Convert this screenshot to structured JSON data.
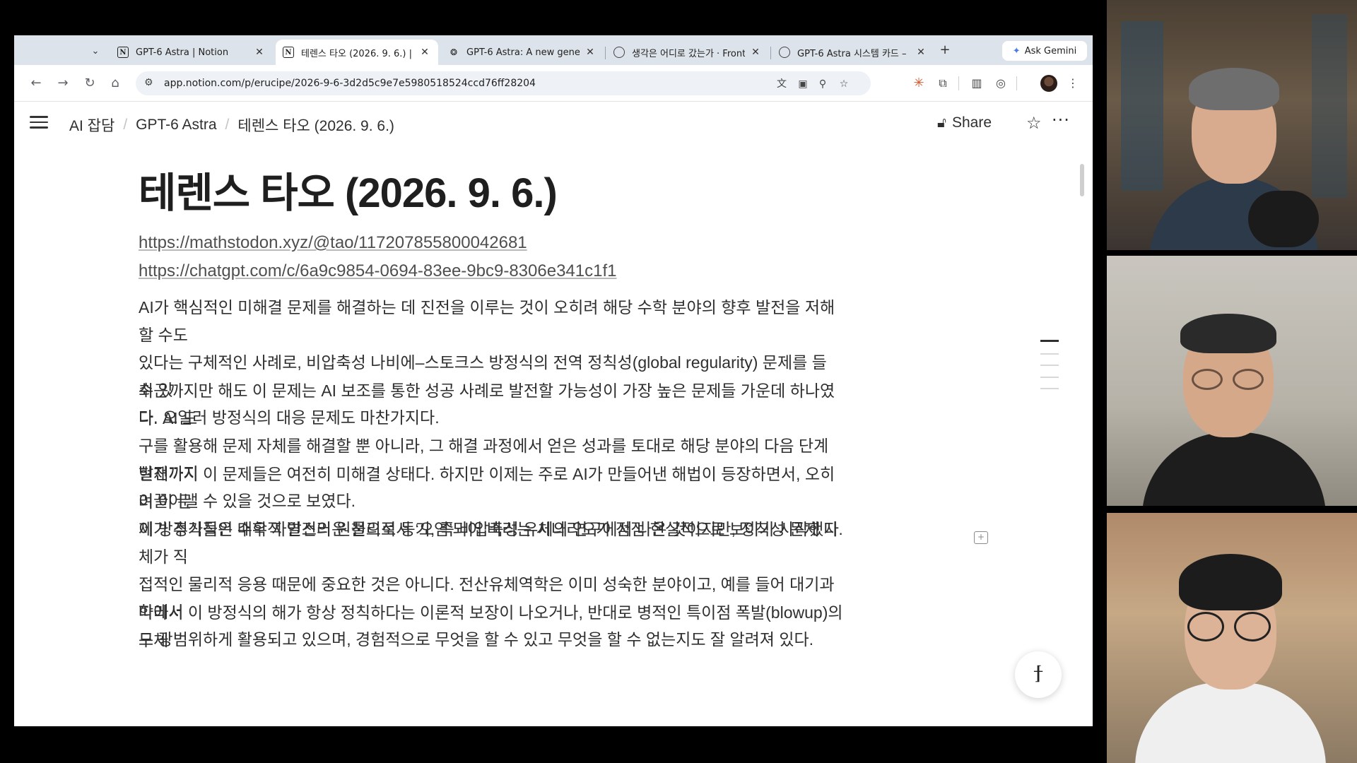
{
  "browser": {
    "tab_dropdown_icon": "chevron-down-icon",
    "tabs": [
      {
        "label": "GPT-6 Astra | Notion",
        "icon": "notion-icon",
        "active": false
      },
      {
        "label": "테렌스 타오 (2026. 9. 6.) |",
        "icon": "notion-icon",
        "active": true
      },
      {
        "label": "GPT-6 Astra: A new gene",
        "icon": "openai-icon",
        "active": false
      },
      {
        "label": "생각은 어디로 갔는가 · Front",
        "icon": "globe-icon",
        "active": false
      },
      {
        "label": "GPT-6 Astra 시스템 카드 –",
        "icon": "globe-icon",
        "active": false
      }
    ],
    "new_tab": "+",
    "gemini_label": "Ask Gemini",
    "url": "app.notion.com/p/erucipe/2026-9-6-3d2d5c9e7e5980518524ccd76ff28204"
  },
  "notion": {
    "breadcrumbs": [
      "AI 잡담",
      "GPT-6 Astra",
      "테렌스 타오 (2026. 9. 6.)"
    ],
    "share_label": "Share",
    "title": "테렌스 타오 (2026. 9. 6.)",
    "links": [
      "https://mathstodon.xyz/@tao/117207855800042681",
      "https://chatgpt.com/c/6a9c9854-0694-83ee-9bc9-8306e341c1f1"
    ],
    "paragraphs": [
      [
        "AI가 핵심적인 미해결 문제를 해결하는 데 진전을 이루는 것이 오히려 해당 수학 분야의 향후 발전을 저해할 수도",
        "있다는 구체적인 사례로, 비압축성 나비에–스토크스 방정식의 전역 정칙성(global regularity) 문제를 들 수 있",
        "다. 오일러 방정식의 대응 문제도 마찬가지다."
      ],
      [
        "최근까지만 해도 이 문제는 AI 보조를 통한 성공 사례로 발전할 가능성이 가장 높은 문제들 가운데 하나였다. AI 도",
        "구를 활용해 문제 자체를 해결할 뿐 아니라, 그 해결 과정에서 얻은 성과를 토대로 해당 분야의 다음 단계 발전까지",
        "이끌어낼 수 있을 것으로 보였다."
      ],
      [
        "현재까지 이 문제들은 여전히 미해결 상태다. 하지만 이제는 주로 AI가 만들어낸 해법이 등장하면서, 오히려 이 문",
        "제가 추가적인 수학적 발전의 원천으로서 ‘오염’되어 버리는 시나리오가 점점 현실적으로 보이기 시작했다."
      ],
      [
        "이 방정식들은 매우 자연스러운 물리적 동기, 즉 비압축성 유체의 연구에서 나온 것이지만, 정칙성 문제 자체가 직",
        "접적인 물리적 응용 때문에 중요한 것은 아니다. 전산유체역학은 이미 성숙한 분야이고, 예를 들어 대기과학에서",
        "도 광범위하게 활용되고 있으며, 경험적으로 무엇을 할 수 있고 무엇을 할 수 없는지도 잘 알려져 있다."
      ],
      [
        "따라서 이 방정식의 해가 항상 정칙하다는 이론적 보장이 나오거나, 반대로 병적인 특이점 폭발(blowup)의 구체"
      ]
    ]
  }
}
